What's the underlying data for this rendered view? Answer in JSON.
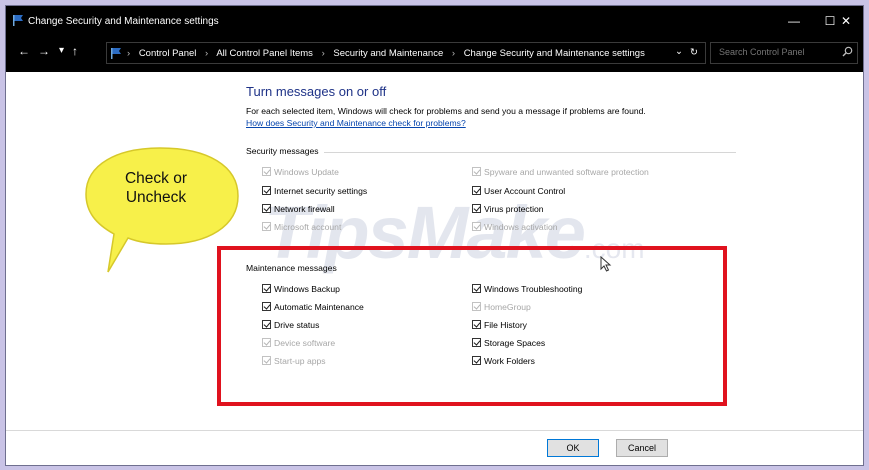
{
  "window": {
    "title": "Change Security and Maintenance settings",
    "minimize": "—",
    "maximize": "☐",
    "close": "✕"
  },
  "addressbar": {
    "back": "←",
    "forward": "→",
    "recent": "▾",
    "up": "↑",
    "breadcrumbs": [
      "Control Panel",
      "All Control Panel Items",
      "Security and Maintenance",
      "Change Security and Maintenance settings"
    ],
    "separator": "›",
    "dropdown": "⌄",
    "refresh": "↻",
    "search_placeholder": "Search Control Panel"
  },
  "main": {
    "heading": "Turn messages on or off",
    "description": "For each selected item, Windows will check for problems and send you a message if problems are found.",
    "help_link": "How does Security and Maintenance check for problems?",
    "security_section": "Security messages",
    "security_items": {
      "windows_update": {
        "label": "Windows Update",
        "checked": true,
        "enabled": false
      },
      "spyware": {
        "label": "Spyware and unwanted software protection",
        "checked": true,
        "enabled": false
      },
      "internet_security": {
        "label": "Internet security settings",
        "checked": true,
        "enabled": true
      },
      "uac": {
        "label": "User Account Control",
        "checked": true,
        "enabled": true
      },
      "network_firewall": {
        "label": "Network firewall",
        "checked": true,
        "enabled": true
      },
      "virus_protection": {
        "label": "Virus protection",
        "checked": true,
        "enabled": true
      },
      "microsoft_account": {
        "label": "Microsoft account",
        "checked": true,
        "enabled": false
      },
      "windows_activation": {
        "label": "Windows activation",
        "checked": true,
        "enabled": false
      }
    },
    "maintenance_section": "Maintenance messages",
    "maintenance_items": {
      "windows_backup": {
        "label": "Windows Backup",
        "checked": true,
        "enabled": true
      },
      "windows_troubleshooting": {
        "label": "Windows Troubleshooting",
        "checked": true,
        "enabled": true
      },
      "automatic_maintenance": {
        "label": "Automatic Maintenance",
        "checked": true,
        "enabled": true
      },
      "homegroup": {
        "label": "HomeGroup",
        "checked": true,
        "enabled": false
      },
      "drive_status": {
        "label": "Drive status",
        "checked": true,
        "enabled": true
      },
      "file_history": {
        "label": "File History",
        "checked": true,
        "enabled": true
      },
      "device_software": {
        "label": "Device software",
        "checked": true,
        "enabled": false
      },
      "storage_spaces": {
        "label": "Storage Spaces",
        "checked": true,
        "enabled": true
      },
      "startup_apps": {
        "label": "Start-up apps",
        "checked": true,
        "enabled": false
      },
      "work_folders": {
        "label": "Work Folders",
        "checked": true,
        "enabled": true
      }
    }
  },
  "callout": {
    "line1": "Check or",
    "line2": "Uncheck",
    "color": "#f7f04a"
  },
  "watermark": {
    "main": "TipsMake",
    "suffix": ".com"
  },
  "highlight_color": "#e0121e",
  "buttons": {
    "ok": "OK",
    "cancel": "Cancel"
  }
}
